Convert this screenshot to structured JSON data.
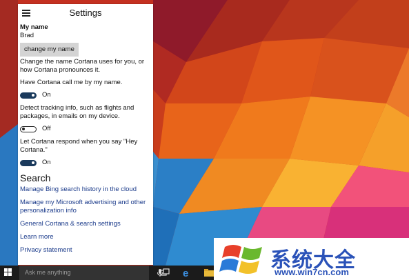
{
  "panel": {
    "title": "Settings",
    "menu_icon": "hamburger-menu-icon",
    "my_name": {
      "heading": "My name",
      "value": "Brad",
      "button_label": "change my name",
      "description": "Change the name Cortana uses for you, or how Cortana pronounces it."
    },
    "settings": [
      {
        "label": "Have Cortana call me by my name.",
        "state": "On",
        "on": true
      },
      {
        "label": "Detect tracking info, such as flights and packages, in emails on my device.",
        "state": "Off",
        "on": false
      },
      {
        "label": "Let Cortana respond when you say \"Hey Cortana.\"",
        "state": "On",
        "on": true
      }
    ],
    "search_section": {
      "heading": "Search",
      "links": [
        "Manage Bing search history in the cloud",
        "Manage my Microsoft advertising and other personalization info",
        "General Cortana & search settings",
        "Learn more",
        "Privacy statement"
      ]
    }
  },
  "taskbar": {
    "search_placeholder": "Ask me anything",
    "icons": [
      "windows-start-icon",
      "microphone-icon",
      "task-view-icon",
      "edge-browser-icon",
      "file-explorer-icon",
      "store-icon"
    ]
  },
  "watermark": {
    "title": "系统大全",
    "url": "www.win7cn.com"
  },
  "colors": {
    "link": "#1a3a8a",
    "toggle_on": "#1a3a5c",
    "taskbar": "#1b1b1b",
    "watermark": "#2a52b8"
  }
}
